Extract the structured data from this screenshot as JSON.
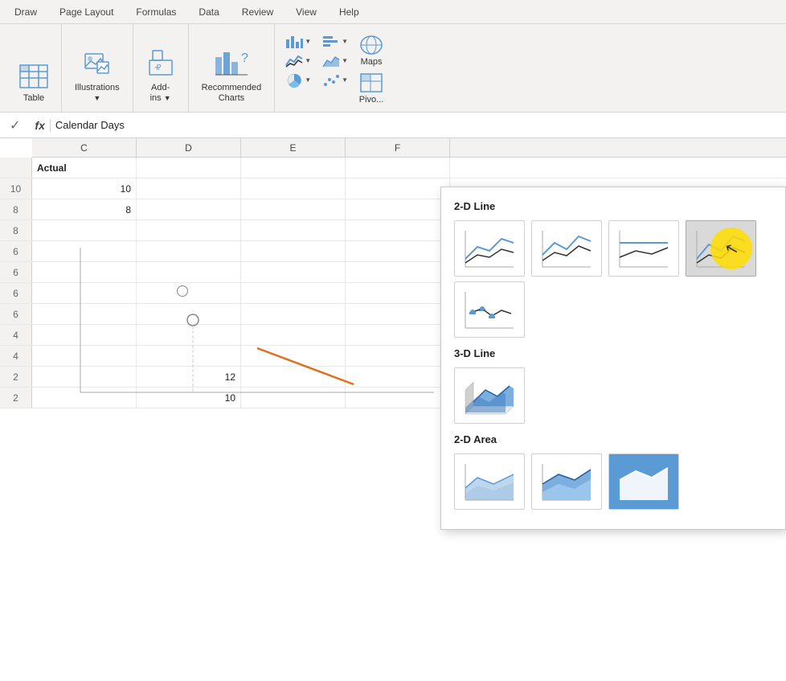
{
  "tabs": [
    {
      "label": "Draw",
      "active": false
    },
    {
      "label": "Page Layout",
      "active": false
    },
    {
      "label": "Formulas",
      "active": false
    },
    {
      "label": "Data",
      "active": false
    },
    {
      "label": "Review",
      "active": false
    },
    {
      "label": "View",
      "active": false
    },
    {
      "label": "Help",
      "active": false
    }
  ],
  "ribbon": {
    "groups": [
      {
        "id": "table",
        "buttons": [
          {
            "id": "table-btn",
            "label": "Table",
            "icon": "⊞"
          }
        ]
      },
      {
        "id": "illustrations",
        "buttons": [
          {
            "id": "illustrations-btn",
            "label": "Illustrations",
            "icon": "🖼"
          }
        ]
      },
      {
        "id": "add-ins",
        "buttons": [
          {
            "id": "add-ins-btn",
            "label": "Add-ins",
            "icon": "🧩"
          }
        ]
      },
      {
        "id": "recommended-charts",
        "buttons": [
          {
            "id": "recommended-charts-btn",
            "label": "Recommended Charts",
            "icon": "📊"
          }
        ]
      },
      {
        "id": "charts",
        "buttons": [
          {
            "id": "column-chart-btn",
            "label": "",
            "icon": "📊"
          },
          {
            "id": "line-chart-btn",
            "label": "",
            "icon": "📈"
          },
          {
            "id": "pie-chart-btn",
            "label": "",
            "icon": "🥧"
          },
          {
            "id": "bar-chart-btn",
            "label": "",
            "icon": "📉"
          },
          {
            "id": "area-chart-btn",
            "label": "",
            "icon": "📊"
          },
          {
            "id": "scatter-chart-btn",
            "label": "",
            "icon": "📊"
          },
          {
            "id": "maps-btn",
            "label": "Maps",
            "icon": "🌐"
          },
          {
            "id": "pivot-btn",
            "label": "Pivo...",
            "icon": "📊"
          }
        ]
      }
    ]
  },
  "formula_bar": {
    "check": "✓",
    "fx": "fx",
    "content": "Calendar Days"
  },
  "col_headers": [
    "C",
    "D",
    "E",
    "F"
  ],
  "rows": [
    {
      "num": "",
      "cells": [
        "Actual",
        "",
        "",
        ""
      ]
    },
    {
      "num": "10",
      "cells": [
        "10",
        "",
        "",
        ""
      ]
    },
    {
      "num": "8",
      "cells": [
        "8",
        "",
        "",
        ""
      ]
    },
    {
      "num": "8",
      "cells": [
        "",
        "",
        "",
        ""
      ]
    },
    {
      "num": "6",
      "cells": [
        "",
        "",
        "",
        ""
      ]
    },
    {
      "num": "6",
      "cells": [
        "",
        "",
        "",
        ""
      ]
    },
    {
      "num": "6",
      "cells": [
        "",
        "",
        "",
        ""
      ]
    },
    {
      "num": "6",
      "cells": [
        "",
        "",
        "",
        ""
      ]
    },
    {
      "num": "4",
      "cells": [
        "",
        "",
        "",
        ""
      ]
    },
    {
      "num": "4",
      "cells": [
        "",
        "",
        "",
        ""
      ]
    },
    {
      "num": "2",
      "cells": [
        "",
        "12",
        "",
        ""
      ]
    },
    {
      "num": "2",
      "cells": [
        "",
        "10",
        "",
        ""
      ]
    }
  ],
  "dropdown": {
    "sections": [
      {
        "title": "2-D Line",
        "charts": [
          {
            "id": "line-2d-1",
            "type": "line-simple"
          },
          {
            "id": "line-2d-2",
            "type": "line-multi"
          },
          {
            "id": "line-2d-3",
            "type": "line-smooth"
          },
          {
            "id": "line-2d-4",
            "type": "line-cursor",
            "highlighted": true
          }
        ]
      },
      {
        "title": "",
        "charts": [
          {
            "id": "line-2d-5",
            "type": "line-stacked"
          }
        ]
      },
      {
        "title": "3-D Line",
        "charts": [
          {
            "id": "line-3d-1",
            "type": "line-3d"
          }
        ]
      },
      {
        "title": "2-D Area",
        "charts": [
          {
            "id": "area-2d-1",
            "type": "area-simple"
          },
          {
            "id": "area-2d-2",
            "type": "area-stacked"
          },
          {
            "id": "area-2d-3",
            "type": "area-filled",
            "active": true
          }
        ]
      }
    ],
    "recommended_label": "Recommended Charts"
  }
}
